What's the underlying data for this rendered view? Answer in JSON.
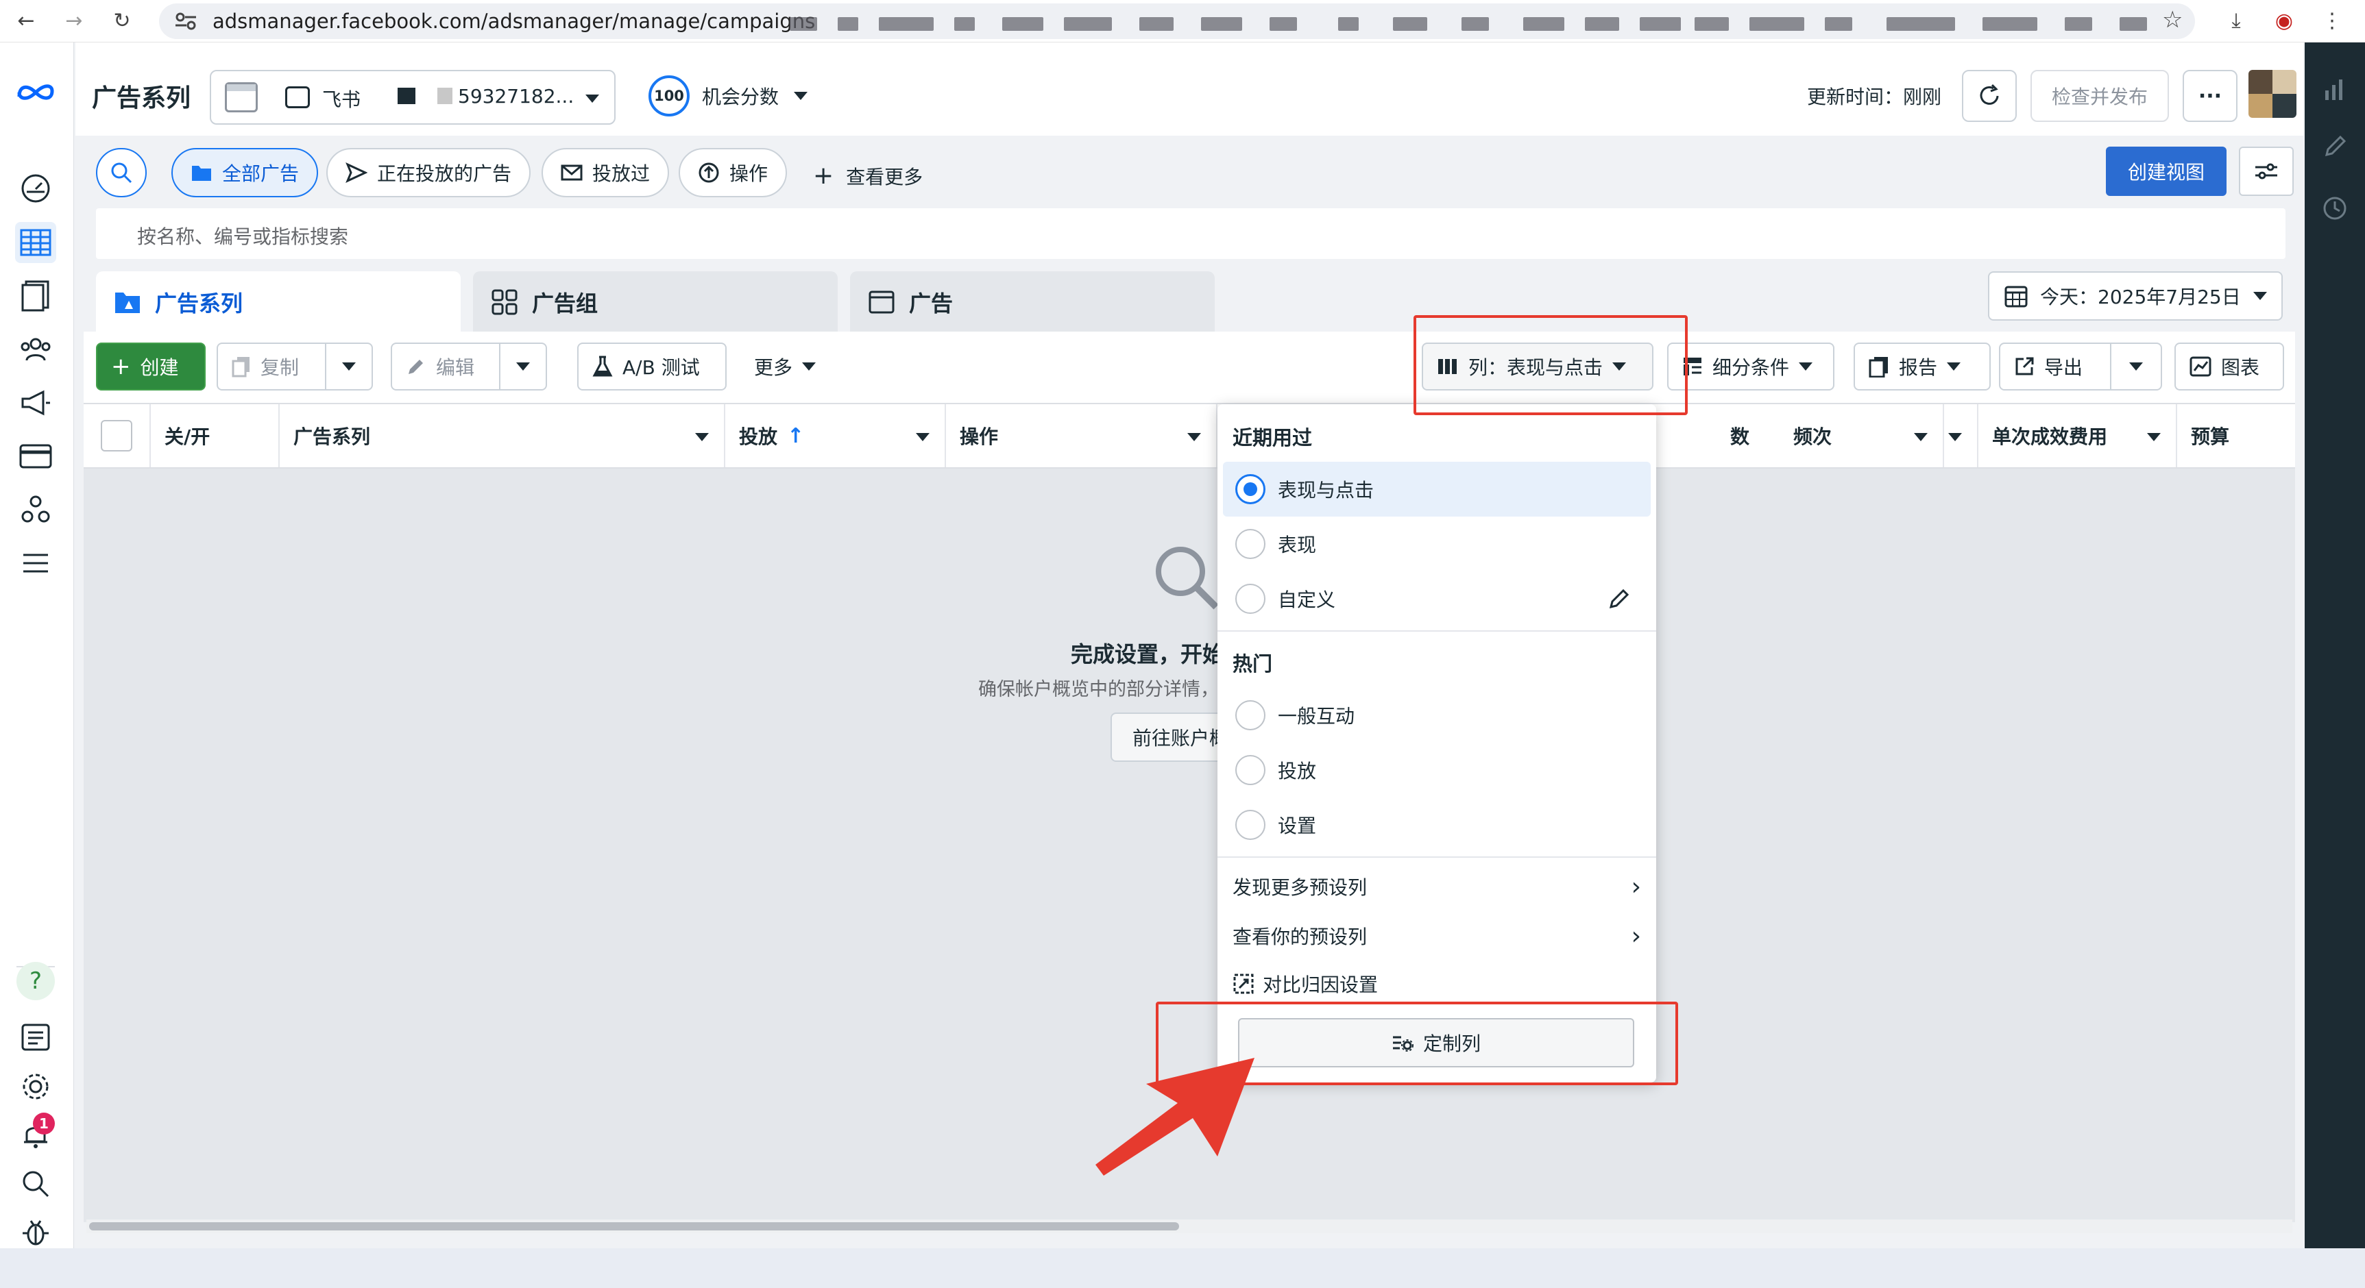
{
  "browser": {
    "url": "adsmanager.facebook.com/adsmanager/manage/campaigns"
  },
  "header": {
    "title": "广告系列",
    "account_name": "飞书",
    "account_id": "59327182...",
    "score_value": "100",
    "score_label": "机会分数",
    "update_label": "更新时间：刚刚",
    "publish_button": "检查并发布",
    "more_button": "···"
  },
  "filters": {
    "items": [
      {
        "label": "全部广告"
      },
      {
        "label": "正在投放的广告"
      },
      {
        "label": "投放过"
      },
      {
        "label": "操作"
      },
      {
        "label": "查看更多"
      }
    ],
    "create_view_button": "创建视图",
    "search_placeholder": "按名称、编号或指标搜索"
  },
  "tabs": [
    {
      "label": "广告系列"
    },
    {
      "label": "广告组"
    },
    {
      "label": "广告"
    }
  ],
  "date_range": "今天：2025年7月25日",
  "toolbar": {
    "create": "创建",
    "copy": "复制",
    "edit": "编辑",
    "ab_test": "A/B 测试",
    "more": "更多",
    "columns": "列：表现与点击",
    "breakdown": "细分条件",
    "report": "报告",
    "export": "导出",
    "chart": "图表"
  },
  "table": {
    "columns": [
      "关/开",
      "广告系列",
      "投放",
      "操作",
      "数",
      "频次",
      "单次成效费用",
      "预算"
    ]
  },
  "empty_state": {
    "title": "完成设置，开始",
    "description": "确保帐户概览中的部分详情，",
    "button": "前往账户概"
  },
  "column_menu": {
    "recent_header": "近期用过",
    "recent_items": [
      "表现与点击",
      "表现",
      "自定义"
    ],
    "selected": "表现与点击",
    "popular_header": "热门",
    "popular_items": [
      "一般互动",
      "投放",
      "设置"
    ],
    "links": [
      "发现更多预设列",
      "查看你的预设列",
      "对比归因设置"
    ],
    "customize_button": "定制列"
  },
  "notifications": {
    "count": "1"
  },
  "colors": {
    "brand_blue": "#1877f2",
    "create_green": "#2e8a3e",
    "annotation_red": "#e63a2e",
    "rail_dark": "#1c2b33"
  }
}
